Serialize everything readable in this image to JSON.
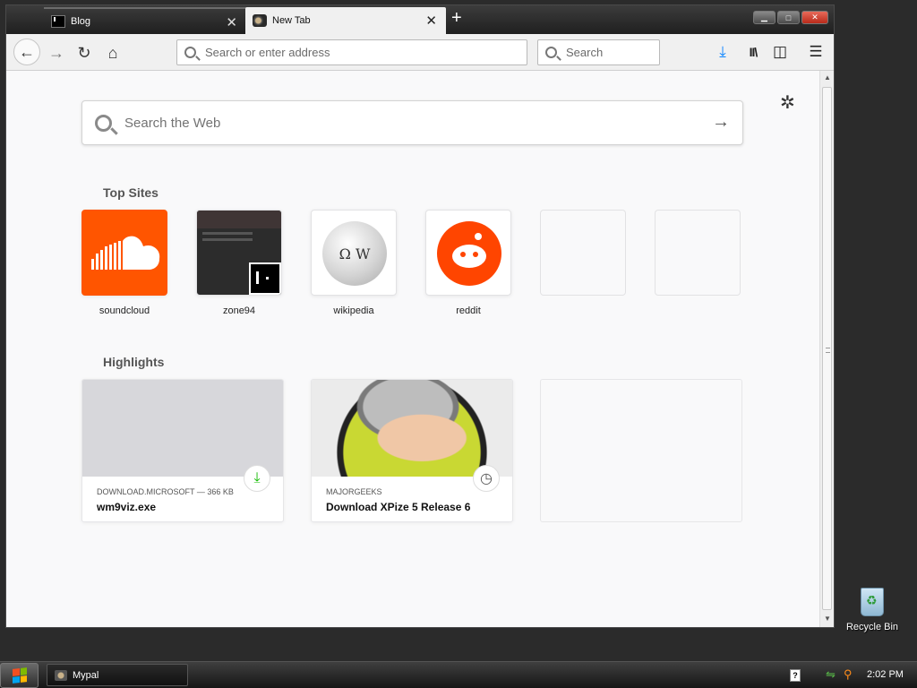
{
  "tabs": [
    {
      "label": "Blog",
      "close": "✕"
    },
    {
      "label": "New Tab",
      "close": "✕"
    }
  ],
  "new_tab_glyph": "+",
  "window_controls": {
    "minimize": "▁",
    "maximize": "□",
    "close": "✕"
  },
  "toolbar": {
    "back_icon": "←",
    "forward_icon": "→",
    "reload_icon": "↻",
    "home_icon": "⌂",
    "url_placeholder": "Search or enter address",
    "search_placeholder": "Search",
    "download_icon": "⤓",
    "library_icon": "II\\",
    "sidebar_icon": "◫",
    "menu_icon": "☰"
  },
  "newtab": {
    "settings_icon": "✲",
    "web_search_placeholder": "Search the Web",
    "go_icon": "→",
    "top_sites_title": "Top Sites",
    "top_sites": [
      {
        "label": "soundcloud"
      },
      {
        "label": "zone94"
      },
      {
        "label": "wikipedia"
      },
      {
        "label": "reddit"
      }
    ],
    "highlights_title": "Highlights",
    "highlights": [
      {
        "source": "DOWNLOAD.MICROSOFT — 366 KB",
        "title": "wm9viz.exe",
        "badge": "⤓"
      },
      {
        "source": "MAJORGEEKS",
        "title": "Download XPize 5 Release 6",
        "badge": "◷"
      }
    ]
  },
  "scrollbar": {
    "up": "▲",
    "down": "▼"
  },
  "desktop": {
    "recycle_bin_label": "Recycle Bin"
  },
  "taskbar": {
    "task_label": "Mypal",
    "help_glyph": "?",
    "clock": "2:02 PM"
  },
  "colors": {
    "accent_download": "#0a84ff",
    "soundcloud": "#ff5500",
    "reddit": "#ff4500",
    "highlight_download_badge": "#12bc00"
  }
}
